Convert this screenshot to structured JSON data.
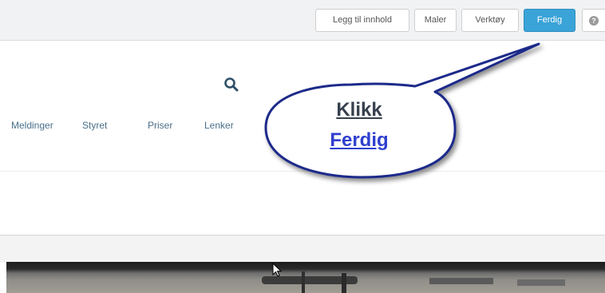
{
  "toolbar": {
    "add_content": "Legg til innhold",
    "templates": "Maler",
    "tools": "Verktøy",
    "done": "Ferdig",
    "help_icon": "question-circle-icon"
  },
  "nav": {
    "items": [
      "Meldinger",
      "Styret",
      "Priser",
      "Lenker"
    ],
    "search_icon": "search-icon"
  },
  "callout": {
    "line1": "Klikk",
    "line2": "Ferdig"
  },
  "colors": {
    "primary_button": "#3aa3d8",
    "nav_link": "#4a6f8a",
    "callout_border": "#1e2a8a",
    "callout_link": "#2f3fcf"
  }
}
